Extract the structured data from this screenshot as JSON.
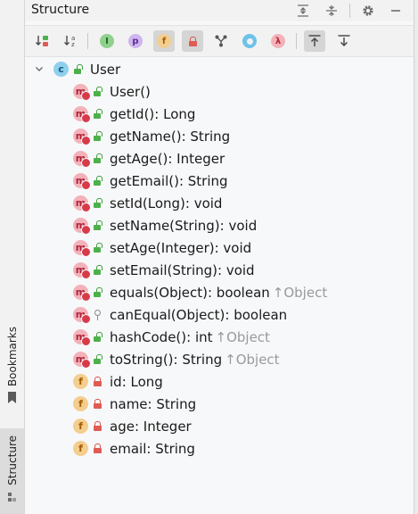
{
  "panel": {
    "title": "Structure"
  },
  "side_tabs": {
    "bookmarks": "Bookmarks",
    "structure": "Structure"
  },
  "header_buttons": [
    "expand-all-icon",
    "collapse-all-icon",
    "gear-icon",
    "minimize-icon"
  ],
  "toolbar": {
    "sort_visibility_icon": "sort-by-visibility-icon",
    "sort_alpha_label": "↓a z",
    "inherited_glyph": "I",
    "properties_glyph": "p",
    "fields_glyph": "f",
    "non_public_icon": "lock-icon",
    "lambdas_glyph": "λ"
  },
  "tree": {
    "root": {
      "kind_glyph": "c",
      "name": "User",
      "visibility": "public"
    },
    "items": [
      {
        "kind": "m",
        "glyph": "m",
        "visibility": "public",
        "signature": "User()",
        "inherited": ""
      },
      {
        "kind": "m",
        "glyph": "m",
        "visibility": "public",
        "signature": "getId(): Long",
        "inherited": ""
      },
      {
        "kind": "m",
        "glyph": "m",
        "visibility": "public",
        "signature": "getName(): String",
        "inherited": ""
      },
      {
        "kind": "m",
        "glyph": "m",
        "visibility": "public",
        "signature": "getAge(): Integer",
        "inherited": ""
      },
      {
        "kind": "m",
        "glyph": "m",
        "visibility": "public",
        "signature": "getEmail(): String",
        "inherited": ""
      },
      {
        "kind": "m",
        "glyph": "m",
        "visibility": "public",
        "signature": "setId(Long): void",
        "inherited": ""
      },
      {
        "kind": "m",
        "glyph": "m",
        "visibility": "public",
        "signature": "setName(String): void",
        "inherited": ""
      },
      {
        "kind": "m",
        "glyph": "m",
        "visibility": "public",
        "signature": "setAge(Integer): void",
        "inherited": ""
      },
      {
        "kind": "m",
        "glyph": "m",
        "visibility": "public",
        "signature": "setEmail(String): void",
        "inherited": ""
      },
      {
        "kind": "m",
        "glyph": "m",
        "visibility": "public",
        "signature": "equals(Object): boolean",
        "inherited": "↑Object"
      },
      {
        "kind": "m",
        "glyph": "m",
        "visibility": "protected",
        "signature": "canEqual(Object): boolean",
        "inherited": ""
      },
      {
        "kind": "m",
        "glyph": "m",
        "visibility": "public",
        "signature": "hashCode(): int",
        "inherited": "↑Object"
      },
      {
        "kind": "m",
        "glyph": "m",
        "visibility": "public",
        "signature": "toString(): String",
        "inherited": "↑Object"
      },
      {
        "kind": "f",
        "glyph": "f",
        "visibility": "private",
        "signature": "id: Long",
        "inherited": ""
      },
      {
        "kind": "f",
        "glyph": "f",
        "visibility": "private",
        "signature": "name: String",
        "inherited": ""
      },
      {
        "kind": "f",
        "glyph": "f",
        "visibility": "private",
        "signature": "age: Integer",
        "inherited": ""
      },
      {
        "kind": "f",
        "glyph": "f",
        "visibility": "private",
        "signature": "email: String",
        "inherited": ""
      }
    ]
  },
  "colors": {
    "method": "#f3b2b9",
    "field": "#f4ce8e",
    "class": "#8fd0ee",
    "public": "#4db04a",
    "private": "#e05b54",
    "inherited_text": "#9a9a9a"
  }
}
